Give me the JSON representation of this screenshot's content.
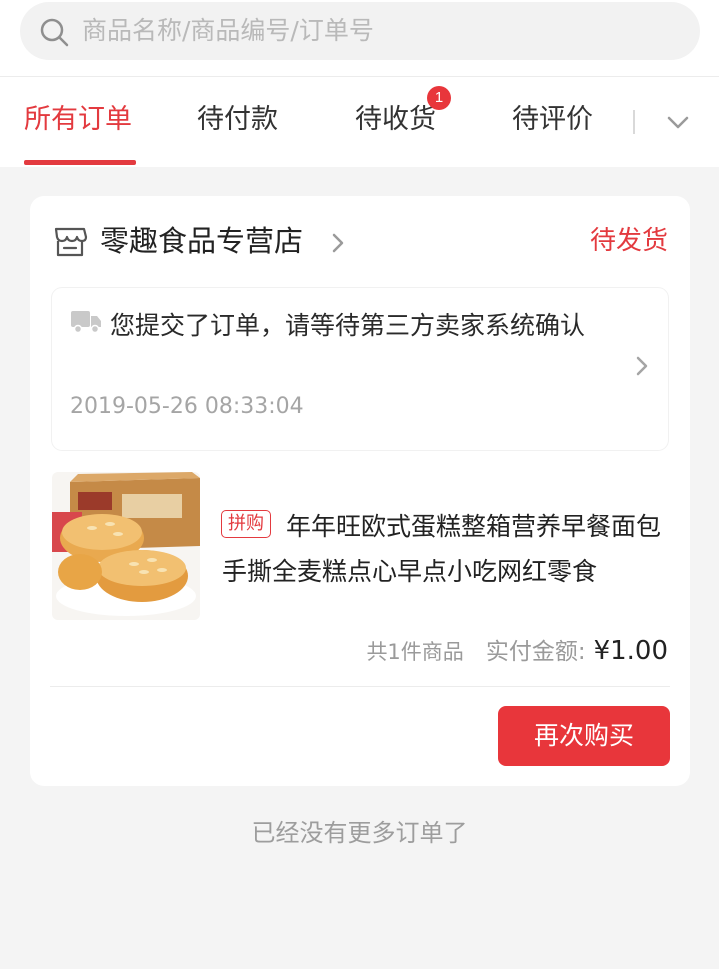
{
  "search": {
    "placeholder": "商品名称/商品编号/订单号"
  },
  "tabs": [
    {
      "label": "所有订单",
      "active": true
    },
    {
      "label": "待付款"
    },
    {
      "label": "待收货",
      "badge": "1"
    },
    {
      "label": "待评价"
    }
  ],
  "order": {
    "store_name": "零趣食品专营店",
    "status": "待发货",
    "notice": "您提交了订单，请等待第三方卖家系统确认",
    "notice_time": "2019-05-26 08:33:04",
    "product": {
      "tag": "拼购",
      "title": "年年旺欧式蛋糕整箱营养早餐面包手撕全麦糕点心早点小吃网红零食"
    },
    "count_text": "共1件商品",
    "paid_label": "实付金额:",
    "paid_amount": "¥1.00",
    "rebuy_label": "再次购买"
  },
  "footer": "已经没有更多订单了",
  "colors": {
    "accent": "#e33a3f",
    "background": "#f4f4f4"
  }
}
